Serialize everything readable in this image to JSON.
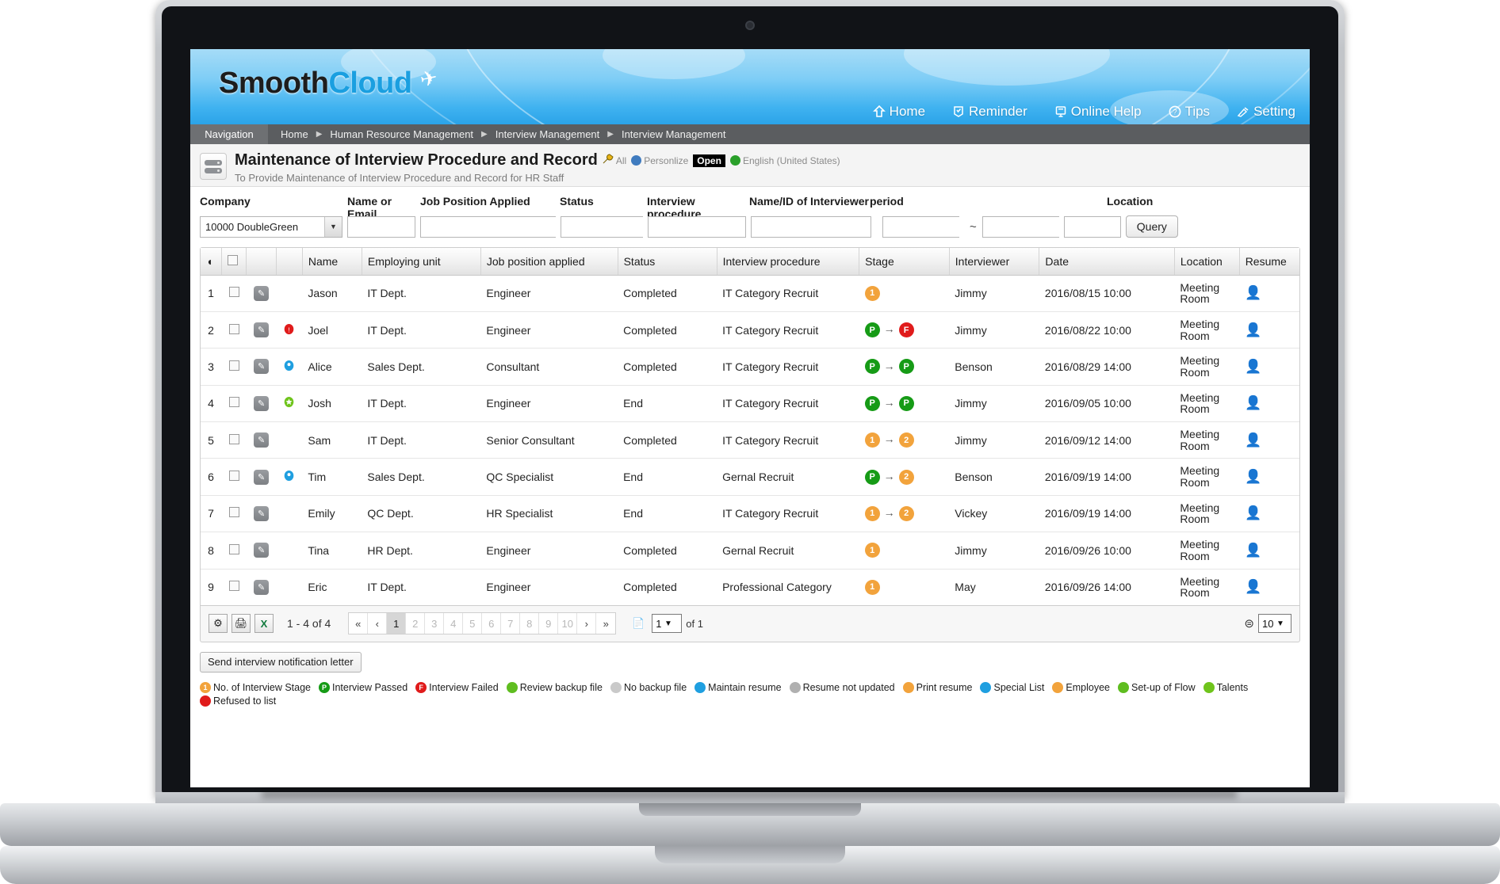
{
  "brand": {
    "part1": "Smooth",
    "part2": "Cloud"
  },
  "topnav": [
    {
      "label": "Home",
      "icon": "home-icon"
    },
    {
      "label": "Reminder",
      "icon": "reminder-icon"
    },
    {
      "label": "Online Help",
      "icon": "online-help-icon"
    },
    {
      "label": "Tips",
      "icon": "tips-icon"
    },
    {
      "label": "Setting",
      "icon": "setting-icon"
    }
  ],
  "breadcrumb": {
    "nav_label": "Navigation",
    "items": [
      "Home",
      "Human Resource Management",
      "Interview Management",
      "Interview Management"
    ]
  },
  "title": {
    "heading": "Maintenance of Interview Procedure and Record",
    "subtitle": "To Provide Maintenance of Interview Procedure and Record for HR Staff",
    "all_label": "All",
    "personalize_label": "Personlize",
    "open_label": "Open",
    "language_label": "English (United States)"
  },
  "filters": {
    "labels": {
      "company": "Company",
      "name_or_email": "Name or Email",
      "job_position": "Job Position Applied",
      "status": "Status",
      "interview_procedure": "Interview procedure",
      "interviewer": "Name/ID of Interviewer",
      "period": "period",
      "location": "Location"
    },
    "company_value": "10000 DoubleGreen",
    "name_or_email_value": "",
    "job_position_value": "",
    "status_value": "",
    "interview_procedure_value": "",
    "interviewer_value": "",
    "period_from": "",
    "period_to": "",
    "period_separator": "~",
    "location_value": "",
    "query_button": "Query"
  },
  "grid": {
    "headers": [
      "Name",
      "Employing unit",
      "Job position applied",
      "Status",
      "Interview procedure",
      "Stage",
      "Interviewer",
      "Date",
      "Location",
      "Resume"
    ],
    "rows": [
      {
        "num": "1",
        "flag": "",
        "name": "Jason",
        "unit": "IT Dept.",
        "position": "Engineer",
        "status": "Completed",
        "procedure": "IT Category Recruit",
        "stage": [
          {
            "t": "1",
            "c": "orange"
          }
        ],
        "interviewer": "Jimmy",
        "date": "2016/08/15 10:00",
        "location": "Meeting Room"
      },
      {
        "num": "2",
        "flag": "refused",
        "name": "Joel",
        "unit": "IT Dept.",
        "position": "Engineer",
        "status": "Completed",
        "procedure": "IT Category Recruit",
        "stage": [
          {
            "t": "P",
            "c": "green"
          },
          {
            "t": "F",
            "c": "red"
          }
        ],
        "interviewer": "Jimmy",
        "date": "2016/08/22 10:00",
        "location": "Meeting Room"
      },
      {
        "num": "3",
        "flag": "special",
        "name": "Alice",
        "unit": "Sales Dept.",
        "position": "Consultant",
        "status": "Completed",
        "procedure": "IT Category Recruit",
        "stage": [
          {
            "t": "P",
            "c": "green"
          },
          {
            "t": "P",
            "c": "green"
          }
        ],
        "interviewer": "Benson",
        "date": "2016/08/29 14:00",
        "location": "Meeting Room"
      },
      {
        "num": "4",
        "flag": "talents",
        "name": "Josh",
        "unit": "IT Dept.",
        "position": "Engineer",
        "status": "End",
        "procedure": "IT Category Recruit",
        "stage": [
          {
            "t": "P",
            "c": "green"
          },
          {
            "t": "P",
            "c": "green"
          }
        ],
        "interviewer": "Jimmy",
        "date": "2016/09/05 10:00",
        "location": "Meeting Room"
      },
      {
        "num": "5",
        "flag": "",
        "name": "Sam",
        "unit": "IT Dept.",
        "position": "Senior Consultant",
        "status": "Completed",
        "procedure": "IT Category Recruit",
        "stage": [
          {
            "t": "1",
            "c": "orange"
          },
          {
            "t": "2",
            "c": "orange"
          }
        ],
        "interviewer": "Jimmy",
        "date": "2016/09/12 14:00",
        "location": "Meeting Room"
      },
      {
        "num": "6",
        "flag": "special",
        "name": "Tim",
        "unit": "Sales Dept.",
        "position": "QC Specialist",
        "status": "End",
        "procedure": "Gernal Recruit",
        "stage": [
          {
            "t": "P",
            "c": "green"
          },
          {
            "t": "2",
            "c": "orange"
          }
        ],
        "interviewer": "Benson",
        "date": "2016/09/19 14:00",
        "location": "Meeting Room"
      },
      {
        "num": "7",
        "flag": "",
        "name": "Emily",
        "unit": "QC Dept.",
        "position": "HR Specialist",
        "status": "End",
        "procedure": "IT Category Recruit",
        "stage": [
          {
            "t": "1",
            "c": "orange"
          },
          {
            "t": "2",
            "c": "orange"
          }
        ],
        "interviewer": "Vickey",
        "date": "2016/09/19 14:00",
        "location": "Meeting Room"
      },
      {
        "num": "8",
        "flag": "",
        "name": "Tina",
        "unit": "HR Dept.",
        "position": "Engineer",
        "status": "Completed",
        "procedure": "Gernal Recruit",
        "stage": [
          {
            "t": "1",
            "c": "orange"
          }
        ],
        "interviewer": "Jimmy",
        "date": "2016/09/26 10:00",
        "location": "Meeting Room"
      },
      {
        "num": "9",
        "flag": "",
        "name": "Eric",
        "unit": "IT Dept.",
        "position": "Engineer",
        "status": "Completed",
        "procedure": "Professional Category",
        "stage": [
          {
            "t": "1",
            "c": "orange"
          }
        ],
        "interviewer": "May",
        "date": "2016/09/26 14:00",
        "location": "Meeting Room"
      }
    ]
  },
  "pager": {
    "range_text": "1 - 4 of 4",
    "pages": [
      "1",
      "2",
      "3",
      "4",
      "5",
      "6",
      "7",
      "8",
      "9",
      "10"
    ],
    "current_page": "1",
    "first_label": "«",
    "prev_label": "‹",
    "next_label": "›",
    "last_label": "»",
    "page_select_value": "1",
    "of_text": "of 1",
    "page_size": "10"
  },
  "actions": {
    "send_letter": "Send interview notification letter"
  },
  "legend": [
    {
      "text": "No. of Interview Stage",
      "icon": "stage-number-icon",
      "color": "#f2a33c",
      "glyph": "1"
    },
    {
      "text": "Interview Passed",
      "icon": "passed-icon",
      "color": "#169b16",
      "glyph": "P"
    },
    {
      "text": "Interview Failed",
      "icon": "failed-icon",
      "color": "#e01b1b",
      "glyph": "F"
    },
    {
      "text": "Review backup file",
      "icon": "review-backup-icon",
      "color": "#5fbd20",
      "glyph": ""
    },
    {
      "text": "No backup file",
      "icon": "no-backup-icon",
      "color": "#c9c9c9",
      "glyph": ""
    },
    {
      "text": "Maintain resume",
      "icon": "maintain-resume-icon",
      "color": "#1f9fe0",
      "glyph": ""
    },
    {
      "text": "Resume not updated",
      "icon": "resume-not-updated-icon",
      "color": "#b0b0b0",
      "glyph": ""
    },
    {
      "text": "Print resume",
      "icon": "print-resume-icon",
      "color": "#f2a33c",
      "glyph": ""
    },
    {
      "text": "Special List",
      "icon": "special-list-icon",
      "color": "#1f9fe0",
      "glyph": ""
    },
    {
      "text": "Employee",
      "icon": "employee-icon",
      "color": "#f2a33c",
      "glyph": ""
    },
    {
      "text": "Set-up of Flow",
      "icon": "setup-flow-icon",
      "color": "#5fbd20",
      "glyph": ""
    },
    {
      "text": "Talents",
      "icon": "talents-icon",
      "color": "#6fc41c",
      "glyph": ""
    },
    {
      "text": "Refused to list",
      "icon": "refused-icon",
      "color": "#e01b1b",
      "glyph": ""
    }
  ],
  "colors": {
    "accent": "#1a9fe0",
    "banner": "#3fb2f0",
    "crumb": "#5b5d60"
  }
}
